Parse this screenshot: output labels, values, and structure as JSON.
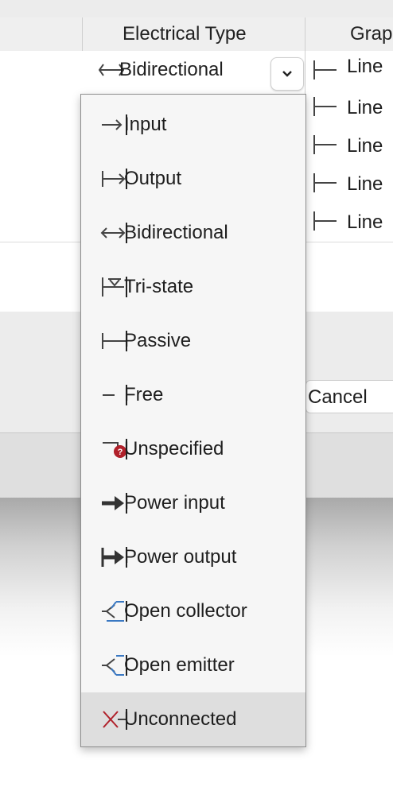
{
  "header": {
    "col_electrical_type": "Electrical Type",
    "col_graphic": "Grap"
  },
  "selected_row": {
    "electrical_type": "Bidirectional",
    "electrical_type_icon": "bidirectional-pin-icon"
  },
  "graphic_values": [
    "Line",
    "Line",
    "Line",
    "Line",
    "Line"
  ],
  "dialog": {
    "cancel_label": "Cancel"
  },
  "dropdown": {
    "selected_index": 11,
    "options": [
      {
        "label": "Input",
        "icon": "input-pin-icon"
      },
      {
        "label": "Output",
        "icon": "output-pin-icon"
      },
      {
        "label": "Bidirectional",
        "icon": "bidirectional-pin-icon"
      },
      {
        "label": "Tri-state",
        "icon": "tristate-pin-icon"
      },
      {
        "label": "Passive",
        "icon": "passive-pin-icon"
      },
      {
        "label": "Free",
        "icon": "free-pin-icon"
      },
      {
        "label": "Unspecified",
        "icon": "unspecified-pin-icon"
      },
      {
        "label": "Power input",
        "icon": "power-input-pin-icon"
      },
      {
        "label": "Power output",
        "icon": "power-output-pin-icon"
      },
      {
        "label": "Open collector",
        "icon": "open-collector-pin-icon"
      },
      {
        "label": "Open emitter",
        "icon": "open-emitter-pin-icon"
      },
      {
        "label": "Unconnected",
        "icon": "unconnected-pin-icon"
      }
    ]
  },
  "colors": {
    "accent_blue": "#3a78c2",
    "unspecified_red": "#b0202a",
    "unconnected_red": "#b0202a"
  }
}
